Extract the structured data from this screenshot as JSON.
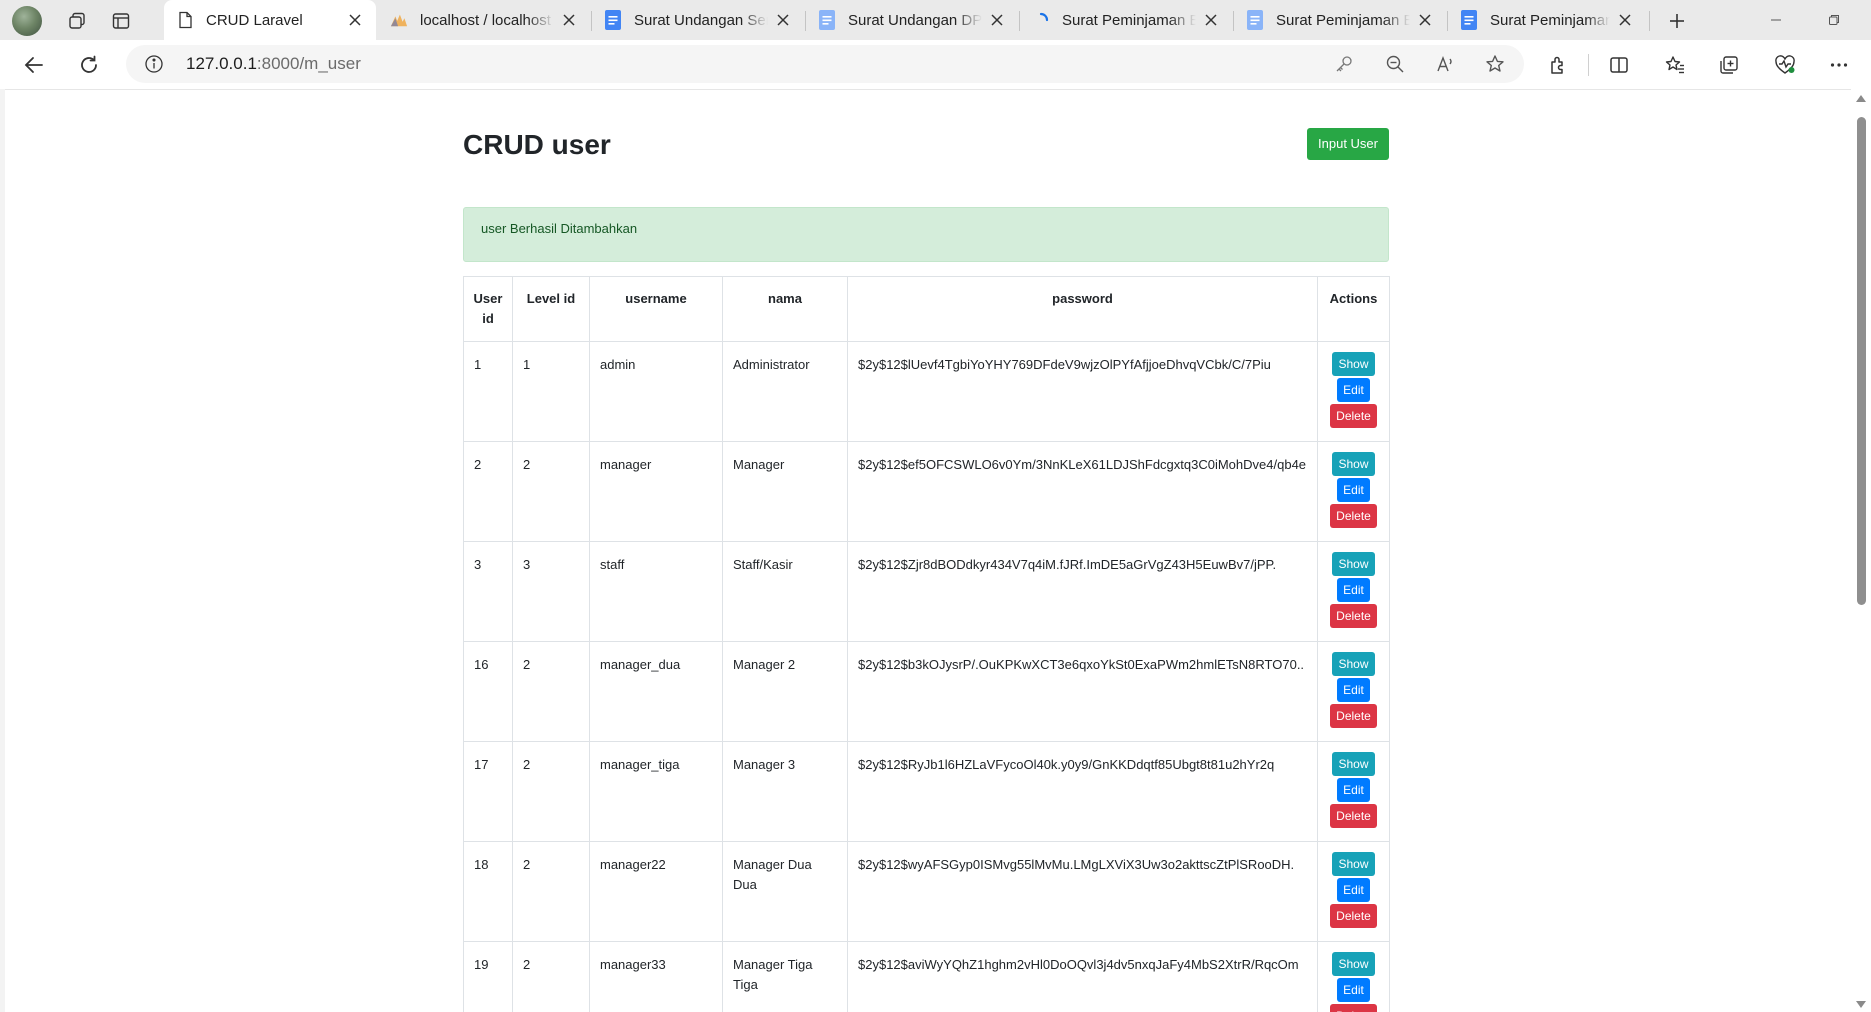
{
  "browser": {
    "tabs": [
      {
        "title": "CRUD Laravel",
        "icon": "page-icon",
        "active": true
      },
      {
        "title": "localhost / localhost",
        "icon": "phpmyadmin-icon",
        "active": false
      },
      {
        "title": "Surat Undangan Seminar",
        "icon": "docs-icon",
        "active": false
      },
      {
        "title": "Surat Undangan DPM",
        "icon": "docs-icon",
        "active": false
      },
      {
        "title": "Surat Peminjaman Barang",
        "icon": "loading-icon",
        "active": false
      },
      {
        "title": "Surat Peminjaman Barang",
        "icon": "docs-icon",
        "active": false
      },
      {
        "title": "Surat Peminjaman Barang",
        "icon": "docs-icon",
        "active": false
      }
    ],
    "url_host": "127.0.0.1",
    "url_path": ":8000/m_user",
    "colors": {
      "docs_blue": "#4285f4",
      "docs_light": "#8ab4f8"
    }
  },
  "page": {
    "title": "CRUD user",
    "input_button": "Input User",
    "alert": "user Berhasil Ditambahkan",
    "columns": [
      "User id",
      "Level id",
      "username",
      "nama",
      "password",
      "Actions"
    ],
    "actions": {
      "show": "Show",
      "edit": "Edit",
      "delete": "Delete"
    },
    "rows": [
      {
        "user_id": "1",
        "level_id": "1",
        "username": "admin",
        "nama": "Administrator",
        "password": "$2y$12$lUevf4TgbiYoYHY769DFdeV9wjzOlPYfAfjjoeDhvqVCbk/C/7Piu"
      },
      {
        "user_id": "2",
        "level_id": "2",
        "username": "manager",
        "nama": "Manager",
        "password": "$2y$12$ef5OFCSWLO6v0Ym/3NnKLeX61LDJShFdcgxtq3C0iMohDve4/qb4e"
      },
      {
        "user_id": "3",
        "level_id": "3",
        "username": "staff",
        "nama": "Staff/Kasir",
        "password": "$2y$12$Zjr8dBODdkyr434V7q4iM.fJRf.ImDE5aGrVgZ43H5EuwBv7/jPP."
      },
      {
        "user_id": "16",
        "level_id": "2",
        "username": "manager_dua",
        "nama": "Manager 2",
        "password": "$2y$12$b3kOJysrP/.OuKPKwXCT3e6qxoYkSt0ExaPWm2hmlETsN8RTO70.."
      },
      {
        "user_id": "17",
        "level_id": "2",
        "username": "manager_tiga",
        "nama": "Manager 3",
        "password": "$2y$12$RyJb1l6HZLaVFycoOl40k.y0y9/GnKKDdqtf85Ubgt8t81u2hYr2q"
      },
      {
        "user_id": "18",
        "level_id": "2",
        "username": "manager22",
        "nama": "Manager Dua Dua",
        "password": "$2y$12$wyAFSGyp0ISMvg55lMvMu.LMgLXViX3Uw3o2akttscZtPlSRooDH."
      },
      {
        "user_id": "19",
        "level_id": "2",
        "username": "manager33",
        "nama": "Manager Tiga Tiga",
        "password": "$2y$12$aviWyYQhZ1hghm2vHl0DoOQvl3j4dv5nxqJaFy4MbS2XtrR/RqcOm"
      }
    ],
    "colors": {
      "success": "#28a745",
      "info": "#17a2b8",
      "primary": "#007bff",
      "danger": "#dc3545",
      "alert_bg": "#d4edda",
      "alert_text": "#155724"
    }
  }
}
